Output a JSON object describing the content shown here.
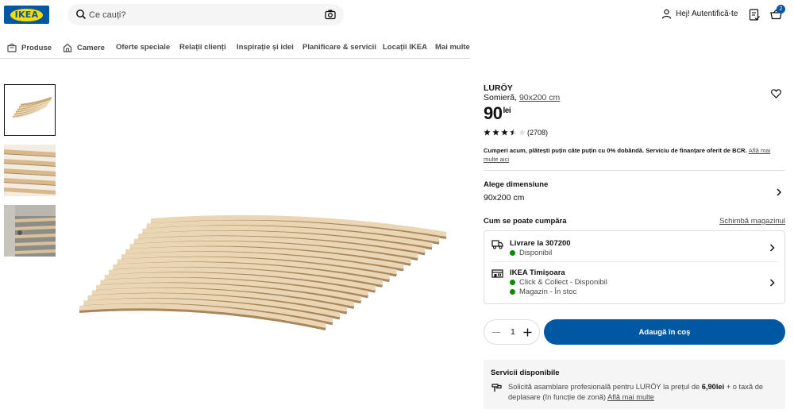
{
  "header": {
    "logo_text": "IKEA",
    "search_placeholder": "Ce cauți?",
    "login_label": "Hej! Autentifică-te",
    "cart_count": "2"
  },
  "nav": {
    "items": [
      {
        "label": "Produse",
        "icon": "shopping-bag-icon"
      },
      {
        "label": "Camere",
        "icon": "home-icon"
      },
      {
        "label": "Oferte speciale"
      },
      {
        "label": "Relații clienți"
      },
      {
        "label": "Inspirație și idei"
      },
      {
        "label": "Planificare & servicii"
      },
      {
        "label": "Locații IKEA"
      },
      {
        "label": "Mai multe"
      }
    ]
  },
  "product": {
    "name": "LURÖY",
    "type": "Somieră,",
    "size_link": "90x200 cm",
    "price": "90",
    "currency": "lei",
    "rating": 3.5,
    "review_count": "(2708)",
    "finance_text": "Cumperi acum, plătești puțin câte puțin cu 0% dobândă. Serviciu de finanțare oferit de BCR.",
    "finance_link": "Află mai multe aici"
  },
  "size": {
    "label": "Alege dimensiune",
    "value": "90x200 cm"
  },
  "purchase": {
    "label": "Cum se poate cumpăra",
    "change_store": "Schimbă magazinul",
    "delivery_title": "Livrare la 307200",
    "delivery_status": "Disponibil",
    "store_title": "IKEA Timișoara",
    "store_line1": "Click & Collect - Disponibil",
    "store_line2": "Magazin - În stoc",
    "status_color": "#0a8a00"
  },
  "cart": {
    "quantity": "1",
    "add_label": "Adaugă în coș",
    "button_color": "#0058a3"
  },
  "services": {
    "title": "Servicii disponibile",
    "text_before": "Solicită asamblare profesională pentru LURÖY la prețul de ",
    "price": "6,90lei",
    "text_after": " + o taxă de deplasare (în funcție de zonă) ",
    "link": "Află mai multe"
  }
}
